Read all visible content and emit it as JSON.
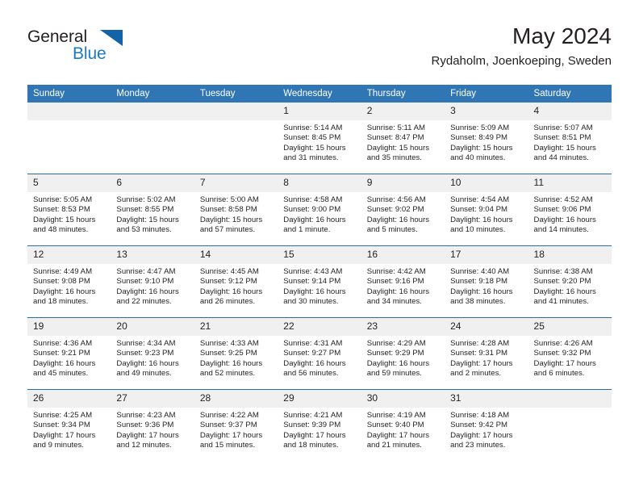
{
  "brand": {
    "name_part1": "General",
    "name_part2": "Blue",
    "logo_icon": "triangle-icon",
    "accent_color": "#1a7ac4",
    "triangle_color": "#1463a8"
  },
  "header": {
    "title": "May 2024",
    "subtitle": "Rydaholm, Joenkoeping, Sweden"
  },
  "theme": {
    "header_blue": "#3076b5",
    "row_divider_blue": "#2e6da4",
    "date_band_gray": "#f0f0f0"
  },
  "calendar": {
    "weekday_headers": [
      "Sunday",
      "Monday",
      "Tuesday",
      "Wednesday",
      "Thursday",
      "Friday",
      "Saturday"
    ],
    "weeks": [
      [
        {
          "day": "",
          "empty": true
        },
        {
          "day": "",
          "empty": true
        },
        {
          "day": "",
          "empty": true
        },
        {
          "day": "1",
          "sunrise": "Sunrise: 5:14 AM",
          "sunset": "Sunset: 8:45 PM",
          "daylight": "Daylight: 15 hours and 31 minutes."
        },
        {
          "day": "2",
          "sunrise": "Sunrise: 5:11 AM",
          "sunset": "Sunset: 8:47 PM",
          "daylight": "Daylight: 15 hours and 35 minutes."
        },
        {
          "day": "3",
          "sunrise": "Sunrise: 5:09 AM",
          "sunset": "Sunset: 8:49 PM",
          "daylight": "Daylight: 15 hours and 40 minutes."
        },
        {
          "day": "4",
          "sunrise": "Sunrise: 5:07 AM",
          "sunset": "Sunset: 8:51 PM",
          "daylight": "Daylight: 15 hours and 44 minutes."
        }
      ],
      [
        {
          "day": "5",
          "sunrise": "Sunrise: 5:05 AM",
          "sunset": "Sunset: 8:53 PM",
          "daylight": "Daylight: 15 hours and 48 minutes."
        },
        {
          "day": "6",
          "sunrise": "Sunrise: 5:02 AM",
          "sunset": "Sunset: 8:55 PM",
          "daylight": "Daylight: 15 hours and 53 minutes."
        },
        {
          "day": "7",
          "sunrise": "Sunrise: 5:00 AM",
          "sunset": "Sunset: 8:58 PM",
          "daylight": "Daylight: 15 hours and 57 minutes."
        },
        {
          "day": "8",
          "sunrise": "Sunrise: 4:58 AM",
          "sunset": "Sunset: 9:00 PM",
          "daylight": "Daylight: 16 hours and 1 minute."
        },
        {
          "day": "9",
          "sunrise": "Sunrise: 4:56 AM",
          "sunset": "Sunset: 9:02 PM",
          "daylight": "Daylight: 16 hours and 5 minutes."
        },
        {
          "day": "10",
          "sunrise": "Sunrise: 4:54 AM",
          "sunset": "Sunset: 9:04 PM",
          "daylight": "Daylight: 16 hours and 10 minutes."
        },
        {
          "day": "11",
          "sunrise": "Sunrise: 4:52 AM",
          "sunset": "Sunset: 9:06 PM",
          "daylight": "Daylight: 16 hours and 14 minutes."
        }
      ],
      [
        {
          "day": "12",
          "sunrise": "Sunrise: 4:49 AM",
          "sunset": "Sunset: 9:08 PM",
          "daylight": "Daylight: 16 hours and 18 minutes."
        },
        {
          "day": "13",
          "sunrise": "Sunrise: 4:47 AM",
          "sunset": "Sunset: 9:10 PM",
          "daylight": "Daylight: 16 hours and 22 minutes."
        },
        {
          "day": "14",
          "sunrise": "Sunrise: 4:45 AM",
          "sunset": "Sunset: 9:12 PM",
          "daylight": "Daylight: 16 hours and 26 minutes."
        },
        {
          "day": "15",
          "sunrise": "Sunrise: 4:43 AM",
          "sunset": "Sunset: 9:14 PM",
          "daylight": "Daylight: 16 hours and 30 minutes."
        },
        {
          "day": "16",
          "sunrise": "Sunrise: 4:42 AM",
          "sunset": "Sunset: 9:16 PM",
          "daylight": "Daylight: 16 hours and 34 minutes."
        },
        {
          "day": "17",
          "sunrise": "Sunrise: 4:40 AM",
          "sunset": "Sunset: 9:18 PM",
          "daylight": "Daylight: 16 hours and 38 minutes."
        },
        {
          "day": "18",
          "sunrise": "Sunrise: 4:38 AM",
          "sunset": "Sunset: 9:20 PM",
          "daylight": "Daylight: 16 hours and 41 minutes."
        }
      ],
      [
        {
          "day": "19",
          "sunrise": "Sunrise: 4:36 AM",
          "sunset": "Sunset: 9:21 PM",
          "daylight": "Daylight: 16 hours and 45 minutes."
        },
        {
          "day": "20",
          "sunrise": "Sunrise: 4:34 AM",
          "sunset": "Sunset: 9:23 PM",
          "daylight": "Daylight: 16 hours and 49 minutes."
        },
        {
          "day": "21",
          "sunrise": "Sunrise: 4:33 AM",
          "sunset": "Sunset: 9:25 PM",
          "daylight": "Daylight: 16 hours and 52 minutes."
        },
        {
          "day": "22",
          "sunrise": "Sunrise: 4:31 AM",
          "sunset": "Sunset: 9:27 PM",
          "daylight": "Daylight: 16 hours and 56 minutes."
        },
        {
          "day": "23",
          "sunrise": "Sunrise: 4:29 AM",
          "sunset": "Sunset: 9:29 PM",
          "daylight": "Daylight: 16 hours and 59 minutes."
        },
        {
          "day": "24",
          "sunrise": "Sunrise: 4:28 AM",
          "sunset": "Sunset: 9:31 PM",
          "daylight": "Daylight: 17 hours and 2 minutes."
        },
        {
          "day": "25",
          "sunrise": "Sunrise: 4:26 AM",
          "sunset": "Sunset: 9:32 PM",
          "daylight": "Daylight: 17 hours and 6 minutes."
        }
      ],
      [
        {
          "day": "26",
          "sunrise": "Sunrise: 4:25 AM",
          "sunset": "Sunset: 9:34 PM",
          "daylight": "Daylight: 17 hours and 9 minutes."
        },
        {
          "day": "27",
          "sunrise": "Sunrise: 4:23 AM",
          "sunset": "Sunset: 9:36 PM",
          "daylight": "Daylight: 17 hours and 12 minutes."
        },
        {
          "day": "28",
          "sunrise": "Sunrise: 4:22 AM",
          "sunset": "Sunset: 9:37 PM",
          "daylight": "Daylight: 17 hours and 15 minutes."
        },
        {
          "day": "29",
          "sunrise": "Sunrise: 4:21 AM",
          "sunset": "Sunset: 9:39 PM",
          "daylight": "Daylight: 17 hours and 18 minutes."
        },
        {
          "day": "30",
          "sunrise": "Sunrise: 4:19 AM",
          "sunset": "Sunset: 9:40 PM",
          "daylight": "Daylight: 17 hours and 21 minutes."
        },
        {
          "day": "31",
          "sunrise": "Sunrise: 4:18 AM",
          "sunset": "Sunset: 9:42 PM",
          "daylight": "Daylight: 17 hours and 23 minutes."
        },
        {
          "day": "",
          "empty": true
        }
      ]
    ]
  }
}
